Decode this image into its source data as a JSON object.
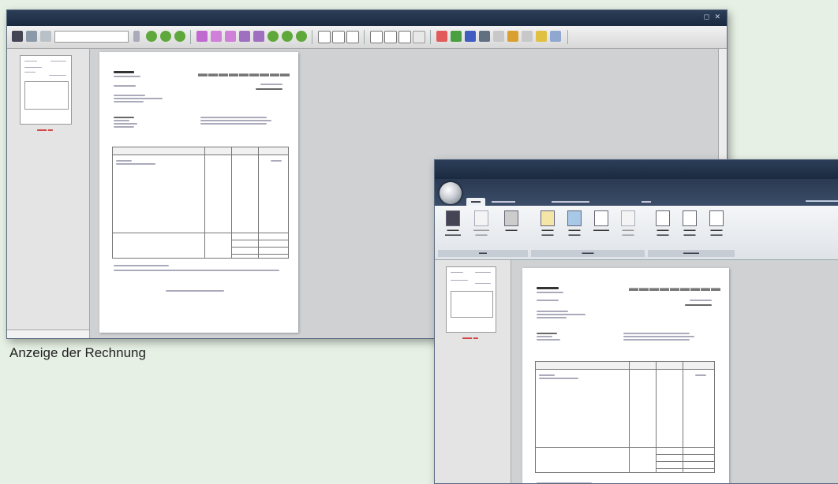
{
  "caption": "Anzeige der Rechnung"
}
